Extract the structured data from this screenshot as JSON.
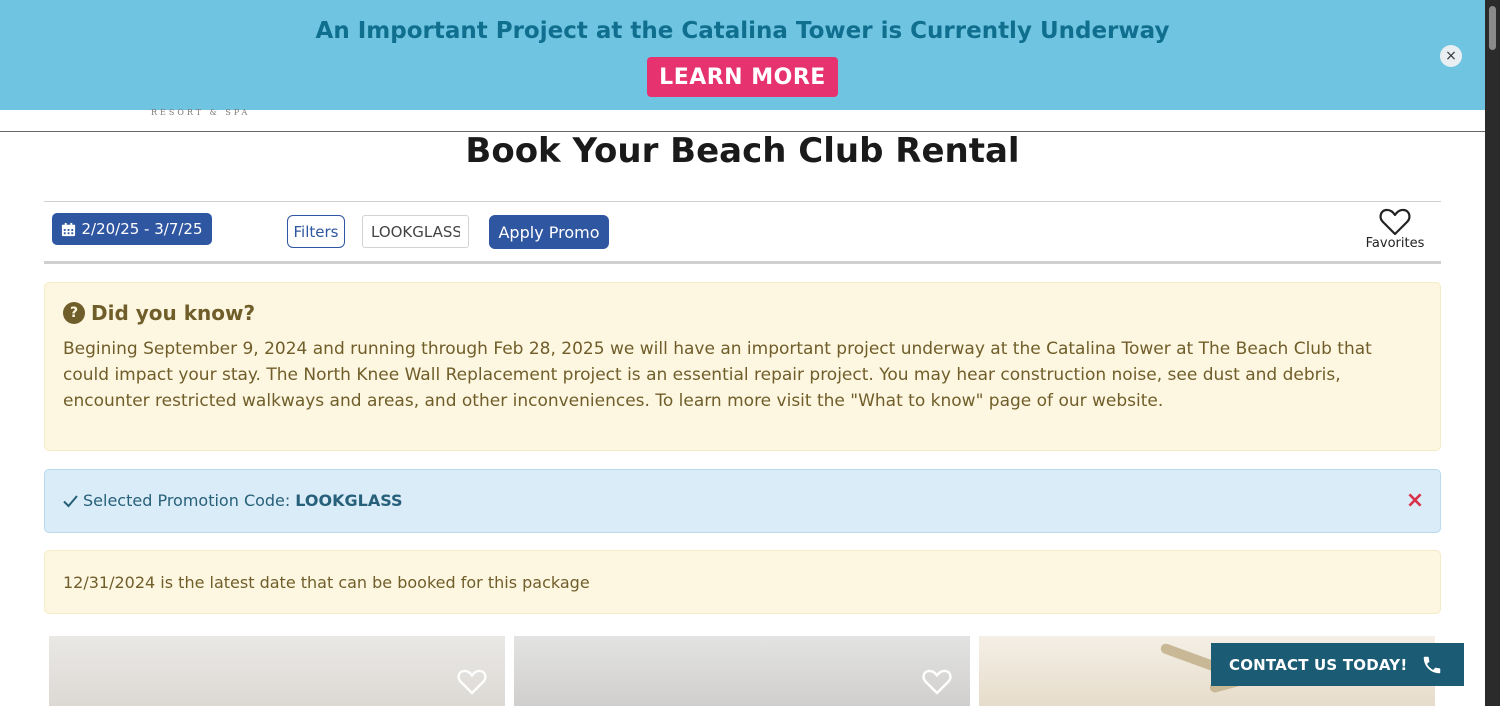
{
  "banner": {
    "title": "An Important Project at the Catalina Tower is Currently Underway",
    "cta_label": "LEARN MORE",
    "close_icon": "×"
  },
  "logo": {
    "subtitle": "RESORT & SPA"
  },
  "page": {
    "title": "Book Your Beach Club Rental"
  },
  "toolbar": {
    "date_range": "2/20/25 - 3/7/25",
    "filters_label": "Filters",
    "promo_input_value": "LOOKGLASS",
    "apply_label": "Apply Promo",
    "favorites_label": "Favorites"
  },
  "notice": {
    "heading": "Did you know?",
    "body": "Begining September 9, 2024 and running through Feb 28, 2025 we will have an important project underway at the Catalina Tower at The Beach Club that could impact your stay. The North Knee Wall Replacement project is an essential repair project. You may hear construction noise, see dust and debris, encounter restricted walkways and areas, and other inconveniences. To learn more visit the \"What to know\" page of our website."
  },
  "promo": {
    "label": "Selected Promotion Code:",
    "code": "LOOKGLASS",
    "close_icon": "×"
  },
  "date_notice": {
    "text": "12/31/2024 is the latest date that can be booked for this package"
  },
  "contact": {
    "label": "CONTACT US TODAY!"
  },
  "colors": {
    "banner_bg": "#6fc5e1",
    "banner_text": "#106f8f",
    "cta_bg": "#e6326e",
    "primary": "#2f56a0",
    "warning_bg": "#fdf6e0",
    "info_bg": "#d9ecf7",
    "contact_bg": "#1b5c74"
  },
  "icons": [
    "calendar-icon",
    "heart-icon",
    "question-circle-icon",
    "check-icon",
    "close-icon",
    "phone-icon"
  ]
}
